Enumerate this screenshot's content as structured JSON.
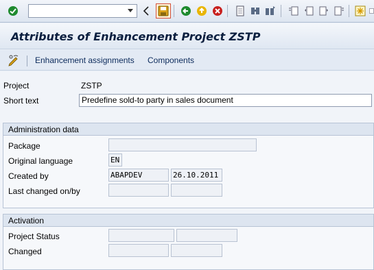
{
  "toolbar": {
    "command_field": {
      "value": "",
      "placeholder": ""
    },
    "icons": [
      "enter-icon",
      "back-nav-icon",
      "save-icon",
      "back-icon",
      "exit-icon",
      "cancel-icon",
      "print-icon",
      "find-icon",
      "find-next-icon",
      "first-page-icon",
      "prev-page-icon",
      "next-page-icon",
      "last-page-icon",
      "new-session-icon"
    ]
  },
  "header": {
    "title": "Attributes of Enhancement Project ZSTP"
  },
  "app_toolbar": {
    "items": [
      {
        "label": "Enhancement assignments"
      },
      {
        "label": "Components"
      }
    ]
  },
  "form": {
    "project_label": "Project",
    "project_value": "ZSTP",
    "short_text_label": "Short text",
    "short_text_value": "Predefine sold-to party in sales document"
  },
  "admin": {
    "heading": "Administration data",
    "package_label": "Package",
    "package_value": "",
    "language_label": "Original language",
    "language_value": "EN",
    "created_label": "Created by",
    "created_by": "ABAPDEV",
    "created_on": "26.10.2011",
    "changed_label": "Last changed on/by",
    "changed_by": "",
    "changed_on": ""
  },
  "activation": {
    "heading": "Activation",
    "status_label": "Project Status",
    "status_value_1": "",
    "status_value_2": "",
    "changed_label": "Changed",
    "changed_value_1": "",
    "changed_value_2": ""
  },
  "colors": {
    "accent_save_border": "#d4503a",
    "enter_green": "#1e8a2e",
    "exit_red": "#c8201e",
    "back_yellow": "#e9b500"
  }
}
